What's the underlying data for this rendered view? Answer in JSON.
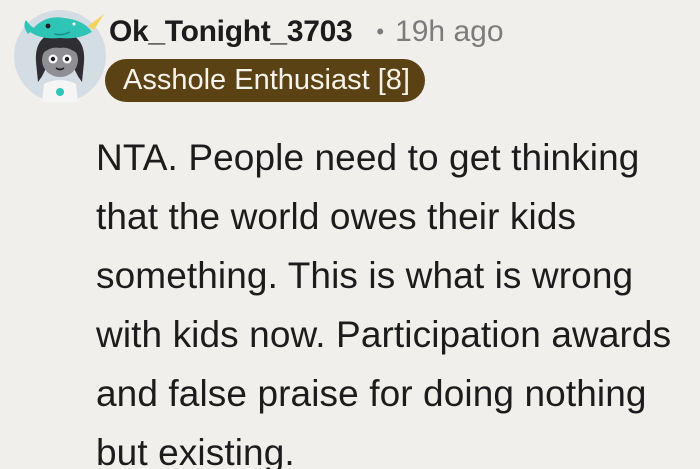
{
  "comment": {
    "author": "Ok_Tonight_3703",
    "separator": "•",
    "time": "19h ago",
    "flair": "Asshole Enthusiast [8]",
    "body": "NTA. People need to get thinking that the world owes their kids something. This is what is wrong with kids now. Participation awards and false praise for doing nothing but existing."
  },
  "avatar": {
    "icon": "snoo-avatar-icon",
    "background_color": "#d4dde4",
    "accessory_color": "#2ec4b6"
  },
  "colors": {
    "page_background": "#f0efec",
    "text": "#1c1c1c",
    "muted_text": "#7c7c7c",
    "flair_background": "#5b4214",
    "flair_text": "#f7f3ea"
  }
}
